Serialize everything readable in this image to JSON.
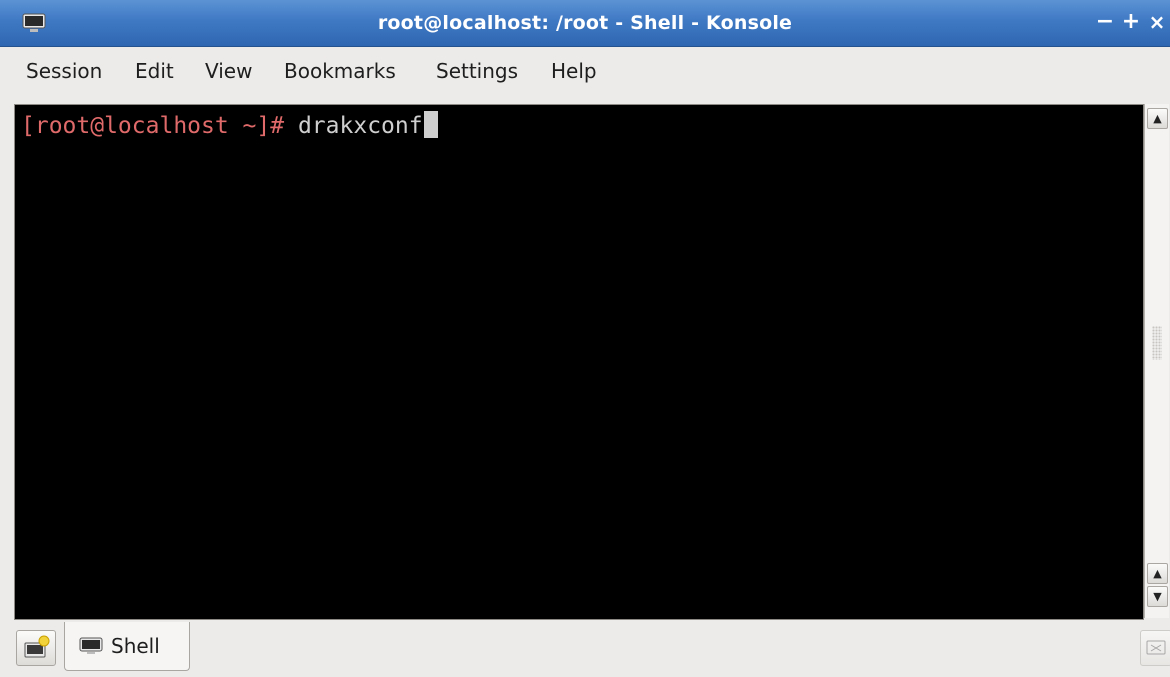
{
  "window": {
    "title": "root@localhost: /root - Shell - Konsole",
    "controls": {
      "minimize": "−",
      "maximize": "+",
      "close": "×"
    },
    "app_icon": "konsole-monitor-icon"
  },
  "menubar": {
    "items": [
      "Session",
      "Edit",
      "View",
      "Bookmarks",
      "Settings",
      "Help"
    ]
  },
  "terminal": {
    "prompt": "[root@localhost ~]#",
    "command": " drakxconf",
    "prompt_color": "#e06a6a",
    "text_color": "#cfcfcf",
    "background": "#000000"
  },
  "tabbar": {
    "tabs": [
      {
        "label": "Shell",
        "icon": "monitor-icon"
      }
    ],
    "new_tab_icon": "new-tab-icon",
    "close_tab_icon": "close-tab-icon"
  },
  "colors": {
    "titlebar": "#3f79c4",
    "chrome": "#ecebe9"
  }
}
